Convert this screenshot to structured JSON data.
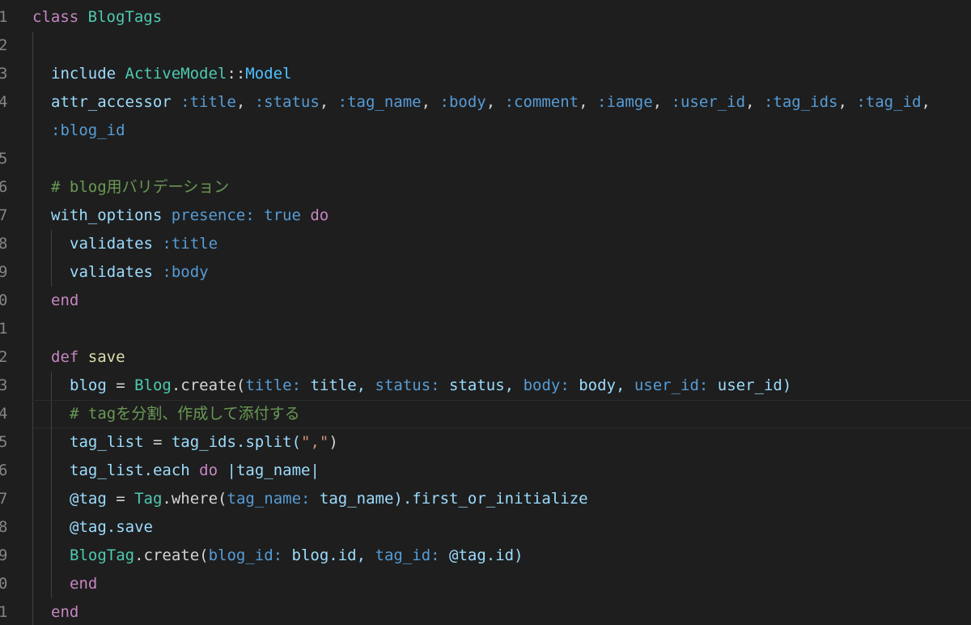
{
  "editor": {
    "language": "ruby",
    "theme_colors": {
      "background": "#1e1e1e",
      "line_number": "#858585",
      "keyword": "#c586c0",
      "class_name": "#4ec9b0",
      "symbol": "#569cd6",
      "comment": "#6a9955",
      "string": "#ce9178",
      "method": "#dcdcaa",
      "variable": "#9cdcfe"
    },
    "current_line_index": 14,
    "lines": [
      {
        "num": "1",
        "indent": 0,
        "tokens": [
          {
            "t": "class",
            "c": "kw"
          },
          {
            "t": " ",
            "c": "ws"
          },
          {
            "t": "BlogTags",
            "c": "cls"
          }
        ]
      },
      {
        "num": "2",
        "indent": 1,
        "tokens": []
      },
      {
        "num": "3",
        "indent": 1,
        "tokens": [
          {
            "t": "include",
            "c": "var"
          },
          {
            "t": " ",
            "c": "ws"
          },
          {
            "t": "ActiveModel",
            "c": "cls"
          },
          {
            "t": "::",
            "c": "plain"
          },
          {
            "t": "Model",
            "c": "sym2"
          }
        ]
      },
      {
        "num": "4",
        "indent": 1,
        "tokens": [
          {
            "t": "attr_accessor",
            "c": "var"
          },
          {
            "t": " ",
            "c": "ws"
          },
          {
            "t": ":title",
            "c": "sym"
          },
          {
            "t": ", ",
            "c": "plain"
          },
          {
            "t": ":status",
            "c": "sym"
          },
          {
            "t": ", ",
            "c": "plain"
          },
          {
            "t": ":tag_name",
            "c": "sym"
          },
          {
            "t": ", ",
            "c": "plain"
          },
          {
            "t": ":body",
            "c": "sym"
          },
          {
            "t": ", ",
            "c": "plain"
          },
          {
            "t": ":comment",
            "c": "sym"
          },
          {
            "t": ", ",
            "c": "plain"
          },
          {
            "t": ":iamge",
            "c": "sym"
          },
          {
            "t": ", ",
            "c": "plain"
          },
          {
            "t": ":user_id",
            "c": "sym"
          },
          {
            "t": ", ",
            "c": "plain"
          },
          {
            "t": ":tag_ids",
            "c": "sym"
          },
          {
            "t": ", ",
            "c": "plain"
          },
          {
            "t": ":tag_id",
            "c": "sym"
          },
          {
            "t": ",",
            "c": "plain"
          }
        ]
      },
      {
        "num": "",
        "indent": 1,
        "tokens": [
          {
            "t": ":blog_id",
            "c": "sym"
          }
        ]
      },
      {
        "num": "5",
        "indent": 1,
        "tokens": []
      },
      {
        "num": "6",
        "indent": 1,
        "tokens": [
          {
            "t": "# blog用バリデーション",
            "c": "cmt"
          }
        ]
      },
      {
        "num": "7",
        "indent": 1,
        "tokens": [
          {
            "t": "with_options",
            "c": "var"
          },
          {
            "t": " ",
            "c": "ws"
          },
          {
            "t": "presence:",
            "c": "sym"
          },
          {
            "t": " ",
            "c": "ws"
          },
          {
            "t": "true",
            "c": "kw2"
          },
          {
            "t": " ",
            "c": "ws"
          },
          {
            "t": "do",
            "c": "kw"
          }
        ]
      },
      {
        "num": "8",
        "indent": 2,
        "tokens": [
          {
            "t": "validates",
            "c": "var"
          },
          {
            "t": " ",
            "c": "ws"
          },
          {
            "t": ":title",
            "c": "sym"
          }
        ]
      },
      {
        "num": "9",
        "indent": 2,
        "tokens": [
          {
            "t": "validates",
            "c": "var"
          },
          {
            "t": " ",
            "c": "ws"
          },
          {
            "t": ":body",
            "c": "sym"
          }
        ]
      },
      {
        "num": "0",
        "indent": 1,
        "tokens": [
          {
            "t": "end",
            "c": "kw"
          }
        ]
      },
      {
        "num": "1",
        "indent": 1,
        "tokens": []
      },
      {
        "num": "2",
        "indent": 1,
        "tokens": [
          {
            "t": "def",
            "c": "kw"
          },
          {
            "t": " ",
            "c": "ws"
          },
          {
            "t": "save",
            "c": "meth"
          }
        ]
      },
      {
        "num": "3",
        "indent": 2,
        "tokens": [
          {
            "t": "blog",
            "c": "var"
          },
          {
            "t": " = ",
            "c": "plain"
          },
          {
            "t": "Blog",
            "c": "cls"
          },
          {
            "t": ".create(",
            "c": "plain"
          },
          {
            "t": "title:",
            "c": "sym"
          },
          {
            "t": " title, ",
            "c": "var"
          },
          {
            "t": "status:",
            "c": "sym"
          },
          {
            "t": " status, ",
            "c": "var"
          },
          {
            "t": "body:",
            "c": "sym"
          },
          {
            "t": " body, ",
            "c": "var"
          },
          {
            "t": "user_id:",
            "c": "sym"
          },
          {
            "t": " user_id)",
            "c": "var"
          }
        ]
      },
      {
        "num": "4",
        "indent": 2,
        "tokens": [
          {
            "t": "# tagを分割、作成して添付する",
            "c": "cmt"
          }
        ]
      },
      {
        "num": "5",
        "indent": 2,
        "tokens": [
          {
            "t": "tag_list",
            "c": "var"
          },
          {
            "t": " = ",
            "c": "plain"
          },
          {
            "t": "tag_ids.split(",
            "c": "var"
          },
          {
            "t": "\",\"",
            "c": "str"
          },
          {
            "t": ")",
            "c": "plain"
          }
        ]
      },
      {
        "num": "6",
        "indent": 2,
        "tokens": [
          {
            "t": "tag_list.each",
            "c": "var"
          },
          {
            "t": " ",
            "c": "ws"
          },
          {
            "t": "do",
            "c": "kw"
          },
          {
            "t": " |tag_name|",
            "c": "var"
          }
        ]
      },
      {
        "num": "7",
        "indent": 2,
        "tokens": [
          {
            "t": "@tag",
            "c": "var"
          },
          {
            "t": " = ",
            "c": "plain"
          },
          {
            "t": "Tag",
            "c": "cls"
          },
          {
            "t": ".where(",
            "c": "plain"
          },
          {
            "t": "tag_name:",
            "c": "sym"
          },
          {
            "t": " tag_name).first_or_initialize",
            "c": "var"
          }
        ]
      },
      {
        "num": "8",
        "indent": 2,
        "tokens": [
          {
            "t": "@tag.save",
            "c": "var"
          }
        ]
      },
      {
        "num": "9",
        "indent": 2,
        "tokens": [
          {
            "t": "BlogTag",
            "c": "cls"
          },
          {
            "t": ".create(",
            "c": "plain"
          },
          {
            "t": "blog_id:",
            "c": "sym"
          },
          {
            "t": " blog.id, ",
            "c": "var"
          },
          {
            "t": "tag_id:",
            "c": "sym"
          },
          {
            "t": " @tag.id)",
            "c": "var"
          }
        ]
      },
      {
        "num": "0",
        "indent": 2,
        "tokens": [
          {
            "t": "end",
            "c": "kw"
          }
        ]
      },
      {
        "num": "1",
        "indent": 1,
        "tokens": [
          {
            "t": "end",
            "c": "kw"
          }
        ]
      }
    ]
  }
}
